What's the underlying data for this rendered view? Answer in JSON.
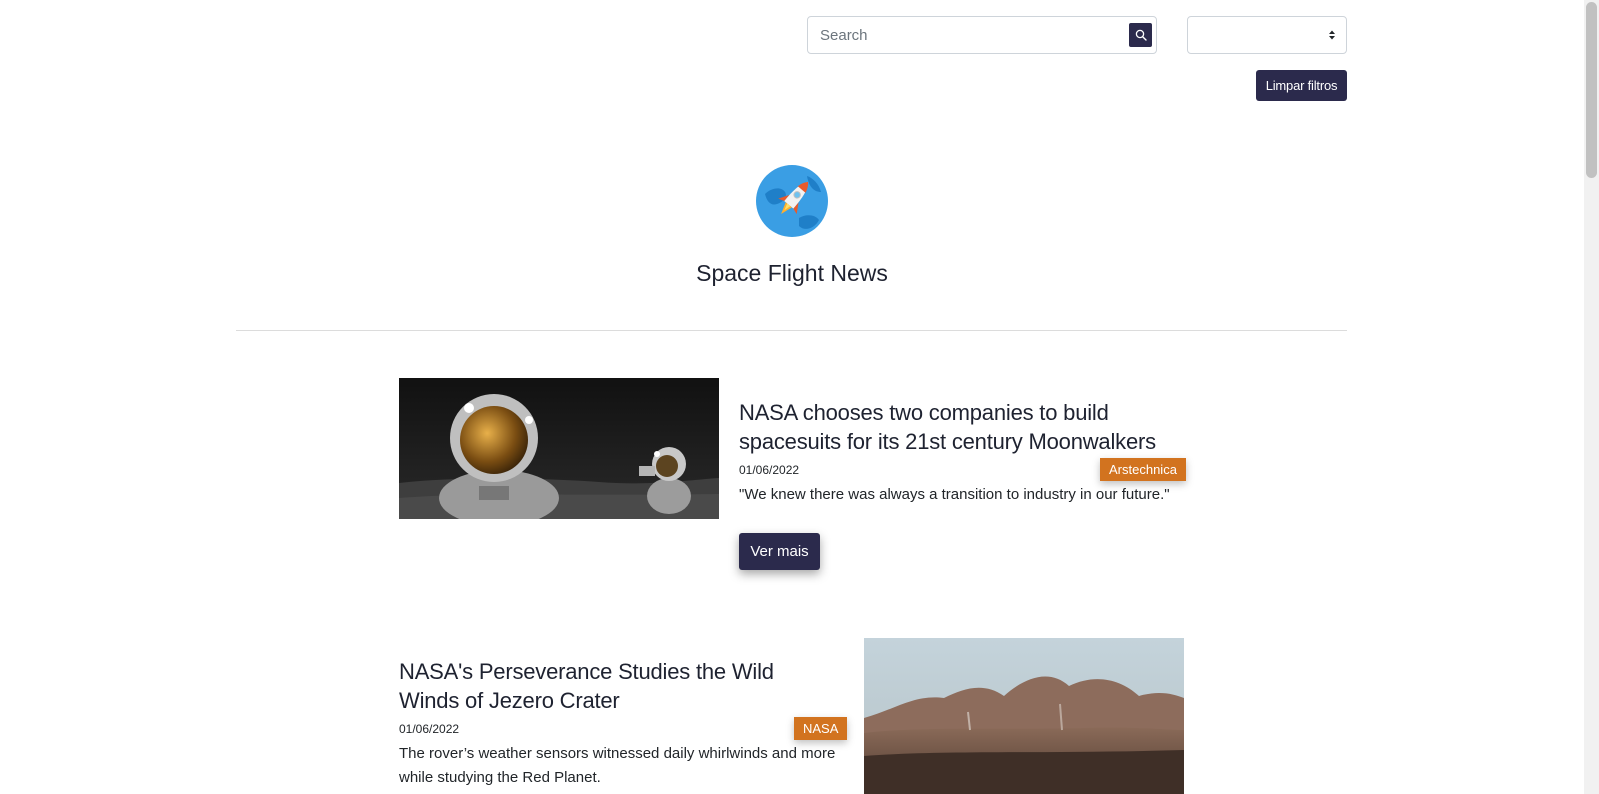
{
  "search": {
    "placeholder": "Search",
    "value": ""
  },
  "filter_select": {
    "selected": ""
  },
  "clear_filters_label": "Limpar filtros",
  "site_title": "Space Flight News",
  "colors": {
    "primary": "#2b2a4c",
    "source_badge": "#d2731f"
  },
  "articles": [
    {
      "title": "NASA chooses two companies to build spacesuits for its 21st century Moonwalkers",
      "date": "01/06/2022",
      "source": "Arstechnica",
      "summary": "\"We knew there was always a transition to industry in our future.\"",
      "button_label": "Ver mais"
    },
    {
      "title": "NASA's Perseverance Studies the Wild Winds of Jezero Crater",
      "date": "01/06/2022",
      "source": "NASA",
      "summary": "The rover’s weather sensors witnessed daily whirlwinds and more while studying the Red Planet."
    }
  ]
}
